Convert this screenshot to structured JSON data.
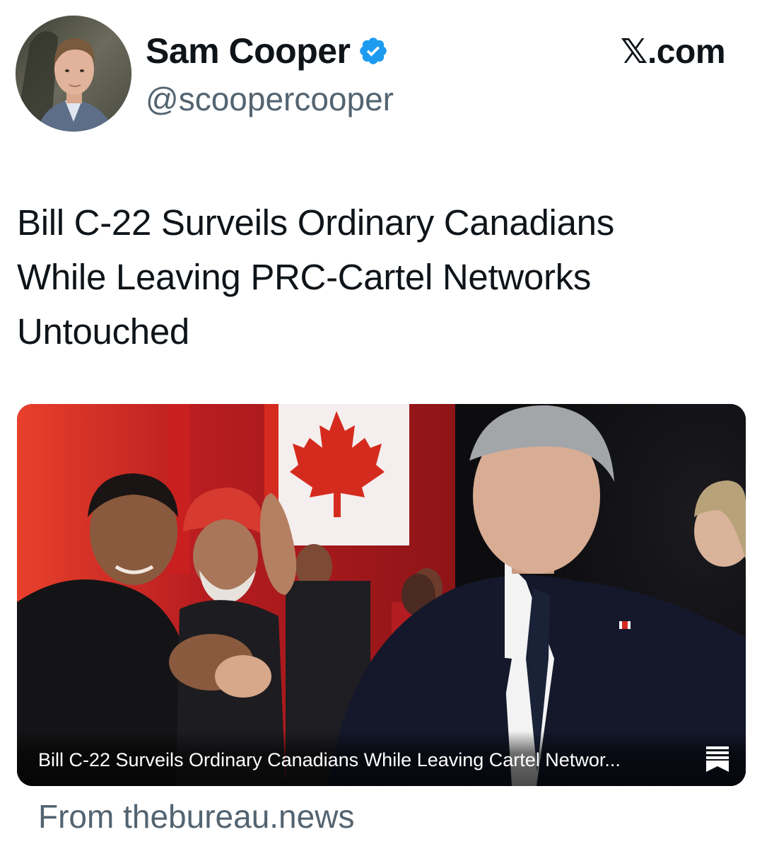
{
  "author": {
    "display_name": "Sam Cooper",
    "handle": "@scoopercooper",
    "verified": true,
    "verified_icon": "verified-badge-icon"
  },
  "brand": "𝕏.com",
  "tweet": {
    "line1": "Bill C-22 Surveils Ordinary Canadians",
    "line2": "While Leaving PRC-Cartel Networks",
    "line3": "Untouched"
  },
  "card": {
    "title": "Bill C-22 Surveils Ordinary Canadians While Leaving Cartel Networ...",
    "icon": "bookmark-icon"
  },
  "source": "From thebureau.news",
  "colors": {
    "verified": "#1d9bf0",
    "secondary_text": "#536471",
    "flag_red": "#d52b1e"
  }
}
